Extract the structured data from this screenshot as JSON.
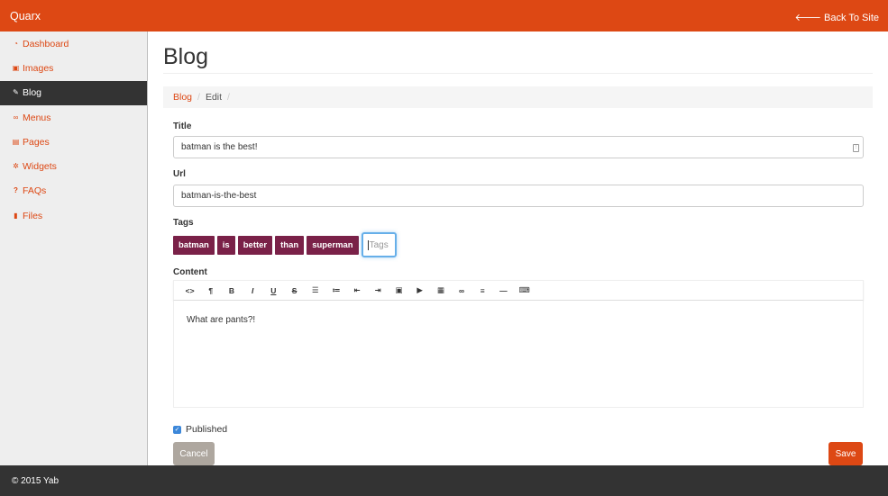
{
  "app": {
    "brand": "Quarx",
    "back_link": "Back To Site"
  },
  "sidebar": {
    "items": [
      {
        "label": "Dashboard",
        "icon": "dashboard-icon"
      },
      {
        "label": "Images",
        "icon": "image-icon"
      },
      {
        "label": "Blog",
        "icon": "pencil-icon",
        "active": true
      },
      {
        "label": "Menus",
        "icon": "link-icon"
      },
      {
        "label": "Pages",
        "icon": "file-icon"
      },
      {
        "label": "Widgets",
        "icon": "gear-icon"
      },
      {
        "label": "FAQs",
        "icon": "question-icon"
      },
      {
        "label": "Files",
        "icon": "file-icon"
      }
    ]
  },
  "page": {
    "title": "Blog"
  },
  "breadcrumb": {
    "items": [
      "Blog",
      "Edit"
    ]
  },
  "form": {
    "title_label": "Title",
    "title_value": "batman is the best!",
    "url_label": "Url",
    "url_value": "batman-is-the-best",
    "tags_label": "Tags",
    "tags": [
      "batman",
      "is",
      "better",
      "than",
      "superman"
    ],
    "tags_placeholder": "Tags",
    "content_label": "Content",
    "content_value": "What are pants?!",
    "published_label": "Published",
    "published": true,
    "cancel_label": "Cancel",
    "save_label": "Save"
  },
  "editor_toolbar": {
    "buttons": [
      "code-icon",
      "paragraph-icon",
      "bold-icon",
      "italic-icon",
      "underline-icon",
      "strikethrough-icon",
      "unordered-list-icon",
      "ordered-list-icon",
      "outdent-icon",
      "indent-icon",
      "image-icon",
      "video-icon",
      "table-icon",
      "link-icon",
      "align-icon",
      "horizontal-rule-icon",
      "keyboard-icon"
    ]
  },
  "footer": {
    "text": "© 2015 Yab"
  },
  "colors": {
    "brand": "#dd4814",
    "tag": "#7a2148",
    "cancel": "#aea79f",
    "dark": "#333333",
    "focus": "#66afe9"
  }
}
